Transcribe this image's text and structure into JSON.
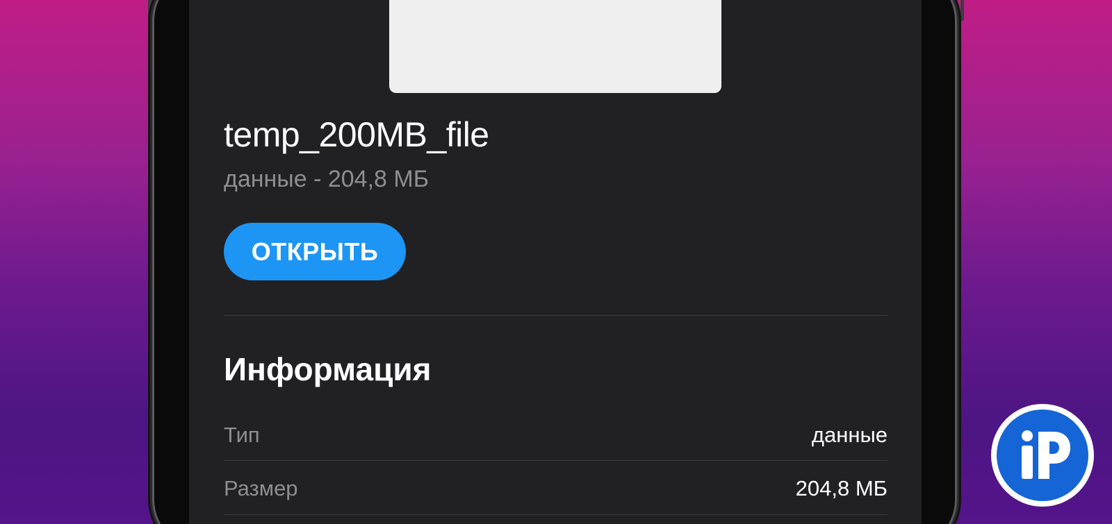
{
  "file": {
    "name": "temp_200MB_file",
    "meta": "данные - 204,8 МБ"
  },
  "actions": {
    "open_label": "ОТКРЫТЬ"
  },
  "info": {
    "title": "Информация",
    "rows": [
      {
        "label": "Тип",
        "value": "данные"
      },
      {
        "label": "Размер",
        "value": "204,8 МБ"
      }
    ]
  },
  "logo": {
    "name": "iphones-ru-logo",
    "text": "iP"
  },
  "colors": {
    "accent": "#1d95f5",
    "screen_bg": "#212123",
    "secondary_text": "#8e8e93",
    "logo_blue": "#1565d6"
  }
}
